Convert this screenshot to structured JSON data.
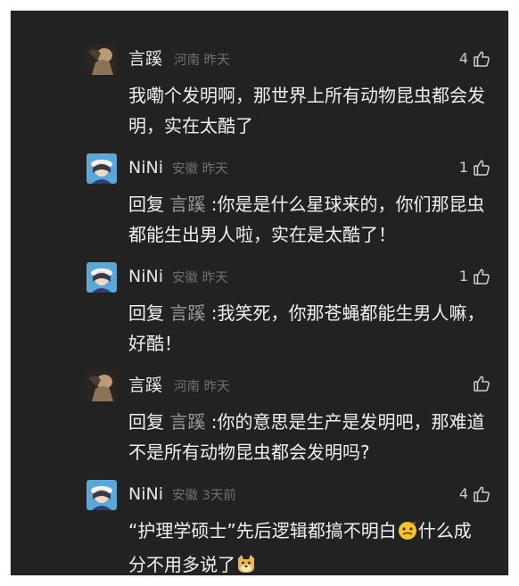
{
  "comments": [
    {
      "author": "言蹊",
      "location": "河南",
      "time": "昨天",
      "likes": "4",
      "avatar_icon": "dark-figure-avatar-icon",
      "reply_label": "",
      "mention": "",
      "text": "我嘞个发明啊，那世界上所有动物昆虫都会发明，实在太酷了"
    },
    {
      "author": "NiNi",
      "location": "安徽",
      "time": "昨天",
      "likes": "1",
      "avatar_icon": "anime-girl-avatar-icon",
      "reply_label": "回复",
      "mention": "言蹊",
      "text": ":你是是什么星球来的，你们那昆虫都能生出男人啦，实在是太酷了！"
    },
    {
      "author": "NiNi",
      "location": "安徽",
      "time": "昨天",
      "likes": "1",
      "avatar_icon": "anime-girl-avatar-icon",
      "reply_label": "回复",
      "mention": "言蹊",
      "text": ":我笑死，你那苍蝇都能生男人嘛，好酷！"
    },
    {
      "author": "言蹊",
      "location": "河南",
      "time": "昨天",
      "likes": "",
      "avatar_icon": "dark-figure-avatar-icon",
      "reply_label": "回复",
      "mention": "言蹊",
      "text": ":你的意思是生产是发明吧，那难道不是所有动物昆虫都会发明吗?"
    },
    {
      "author": "NiNi",
      "location": "安徽",
      "time": "3天前",
      "likes": "4",
      "avatar_icon": "anime-girl-avatar-icon",
      "reply_label": "",
      "mention": "",
      "text_part1": "“护理学硕士”先后逻辑都搞不明白",
      "text_part2": "什么成分不用多说了",
      "emoji1": "dizzy-face-emoji",
      "emoji2": "doge-emoji"
    }
  ],
  "colors": {
    "panel_bg": "#222222",
    "name": "#e6e6e6",
    "meta": "#707070",
    "body": "#f0f0f0",
    "mention": "#9a9a9a"
  }
}
